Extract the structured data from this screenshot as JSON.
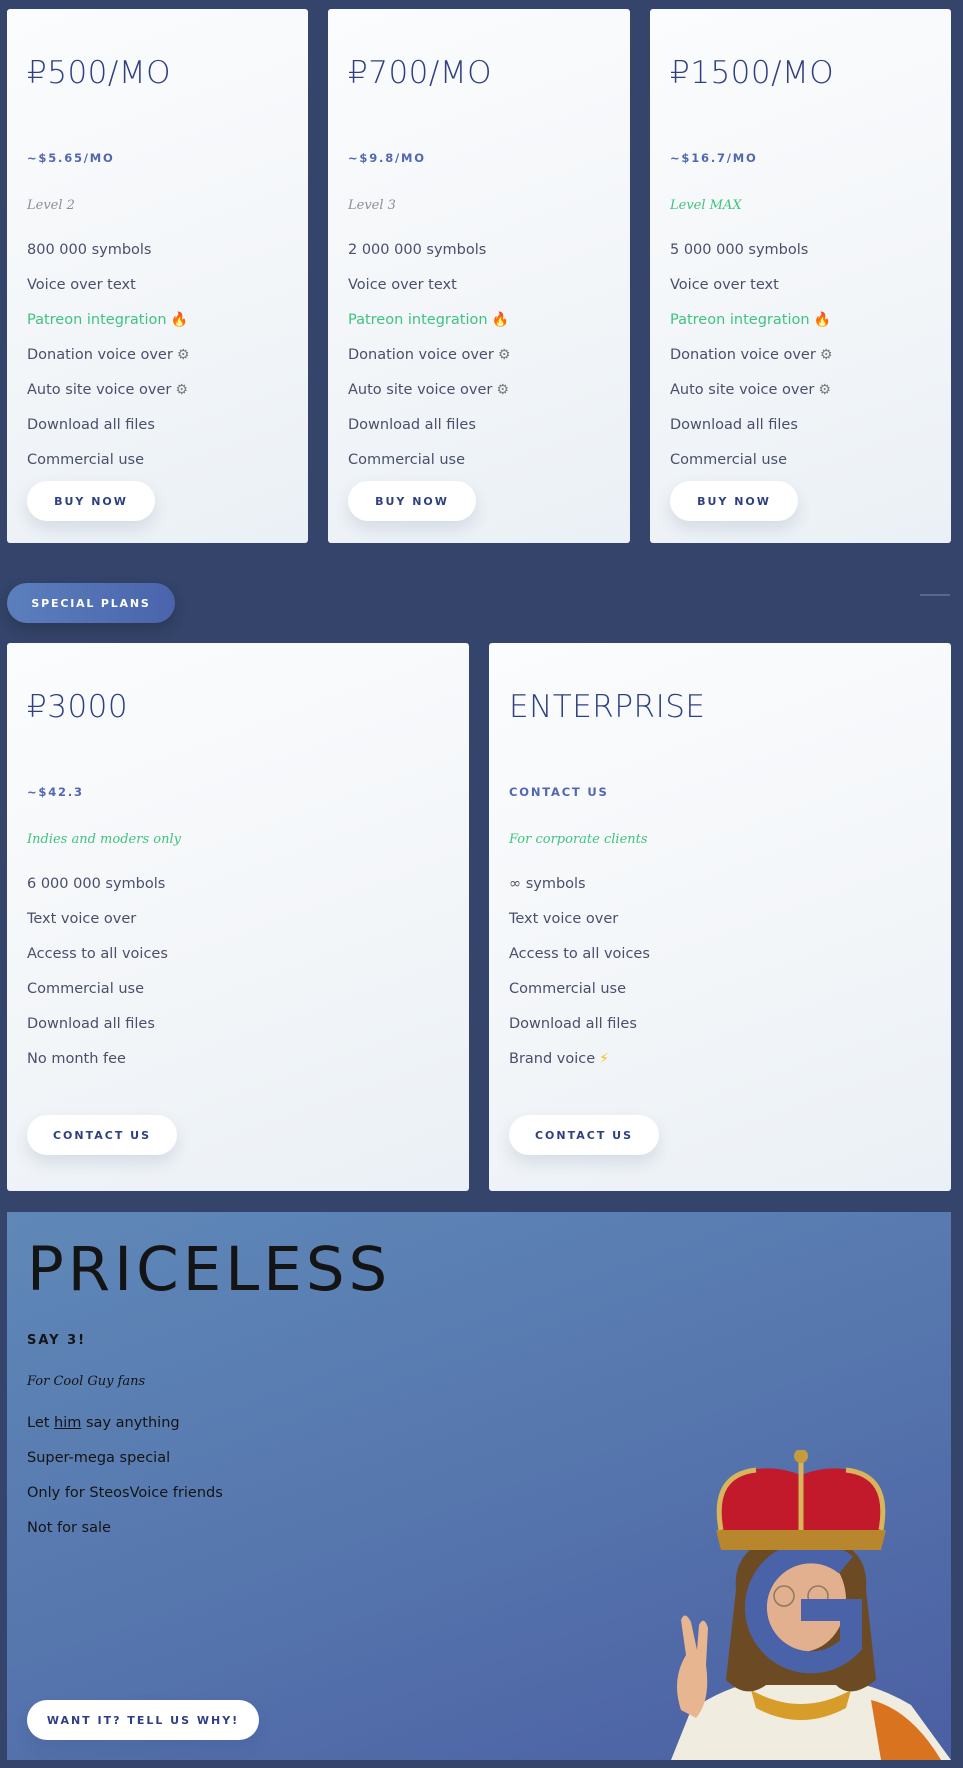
{
  "plans": [
    {
      "price": "₽500/MO",
      "usd": "~$5.65/MO",
      "level": "Level 2",
      "features": [
        {
          "text": "800 000 symbols",
          "icon": null,
          "highlight": false
        },
        {
          "text": "Voice over text",
          "icon": null,
          "highlight": false
        },
        {
          "text": "Patreon integration",
          "icon": "fire-icon",
          "highlight": true
        },
        {
          "text": "Donation voice over",
          "icon": "gear-icon",
          "highlight": false
        },
        {
          "text": "Auto site voice over",
          "icon": "gear-icon",
          "highlight": false
        },
        {
          "text": "Download all files",
          "icon": null,
          "highlight": false
        },
        {
          "text": "Commercial use",
          "icon": null,
          "highlight": false
        }
      ],
      "button": "BUY NOW"
    },
    {
      "price": "₽700/MO",
      "usd": "~$9.8/MO",
      "level": "Level 3",
      "features": [
        {
          "text": "2 000 000 symbols",
          "icon": null,
          "highlight": false
        },
        {
          "text": "Voice over text",
          "icon": null,
          "highlight": false
        },
        {
          "text": "Patreon integration",
          "icon": "fire-icon",
          "highlight": true
        },
        {
          "text": "Donation voice over",
          "icon": "gear-icon",
          "highlight": false
        },
        {
          "text": "Auto site voice over",
          "icon": "gear-icon",
          "highlight": false
        },
        {
          "text": "Download all files",
          "icon": null,
          "highlight": false
        },
        {
          "text": "Commercial use",
          "icon": null,
          "highlight": false
        }
      ],
      "button": "BUY NOW"
    },
    {
      "price": "₽1500/MO",
      "usd": "~$16.7/MO",
      "level": "Level MAX",
      "features": [
        {
          "text": "5 000 000 symbols",
          "icon": null,
          "highlight": false
        },
        {
          "text": "Voice over text",
          "icon": null,
          "highlight": false
        },
        {
          "text": "Patreon integration",
          "icon": "fire-icon",
          "highlight": true
        },
        {
          "text": "Donation voice over",
          "icon": "gear-icon",
          "highlight": false
        },
        {
          "text": "Auto site voice over",
          "icon": "gear-icon",
          "highlight": false
        },
        {
          "text": "Download all files",
          "icon": null,
          "highlight": false
        },
        {
          "text": "Commercial use",
          "icon": null,
          "highlight": false
        }
      ],
      "button": "BUY NOW"
    }
  ],
  "special_plans_label": "SPECIAL PLANS",
  "special": [
    {
      "price": "₽3000",
      "usd": "~$42.3",
      "level": "Indies and moders only",
      "features": [
        {
          "text": "6 000 000 symbols",
          "icon": null
        },
        {
          "text": "Text voice over",
          "icon": null
        },
        {
          "text": "Access to all voices",
          "icon": null
        },
        {
          "text": "Commercial use",
          "icon": null
        },
        {
          "text": "Download all files",
          "icon": null
        },
        {
          "text": "No month fee",
          "icon": null
        }
      ],
      "button": "CONTACT US"
    },
    {
      "price": "ENTERPRISE",
      "usd": "CONTACT US",
      "level": "For corporate clients",
      "features": [
        {
          "text": "∞ symbols",
          "icon": null
        },
        {
          "text": "Text voice over",
          "icon": null
        },
        {
          "text": "Access to all voices",
          "icon": null
        },
        {
          "text": "Commercial use",
          "icon": null
        },
        {
          "text": "Download all files",
          "icon": null
        },
        {
          "text": "Brand voice",
          "icon": "lightning-icon"
        }
      ],
      "button": "CONTACT US"
    }
  ],
  "priceless": {
    "title": "PRICELESS",
    "subtitle": "SAY 3!",
    "tagline": "For Cool Guy fans",
    "feature1_pre": "Let ",
    "feature1_link": "him",
    "feature1_post": " say anything",
    "features": [
      "Super-mega special",
      "Only for SteosVoice friends",
      "Not for sale"
    ],
    "button": "WANT IT? TELL US WHY!",
    "image_label": "Crowned Gabe with G logo"
  },
  "icons": {
    "fire-icon": "🔥",
    "gear-icon": "⚙",
    "lightning-icon": "⚡"
  },
  "colors": {
    "background": "#34446a",
    "accent": "#2e3f82",
    "green": "#3fc382",
    "usd": "#5267b0"
  }
}
